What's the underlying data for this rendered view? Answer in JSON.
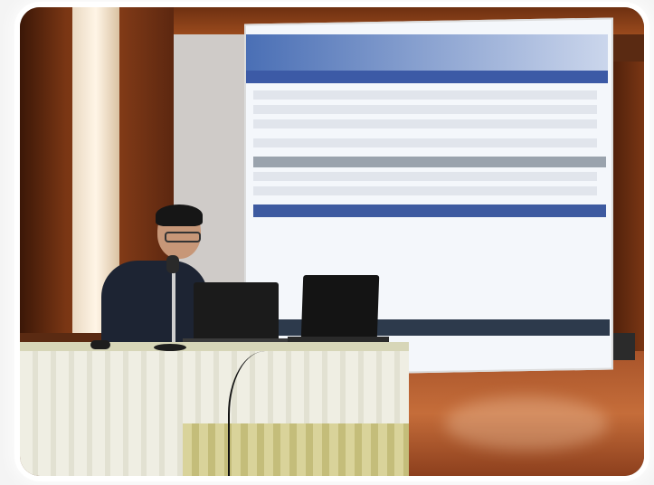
{
  "photo": {
    "scene": "presentation",
    "colors": {
      "wood": "#7a3614",
      "screen": "#f4f7fb",
      "table_cloth": "#efeee3",
      "floor": "#c56d3a"
    }
  }
}
